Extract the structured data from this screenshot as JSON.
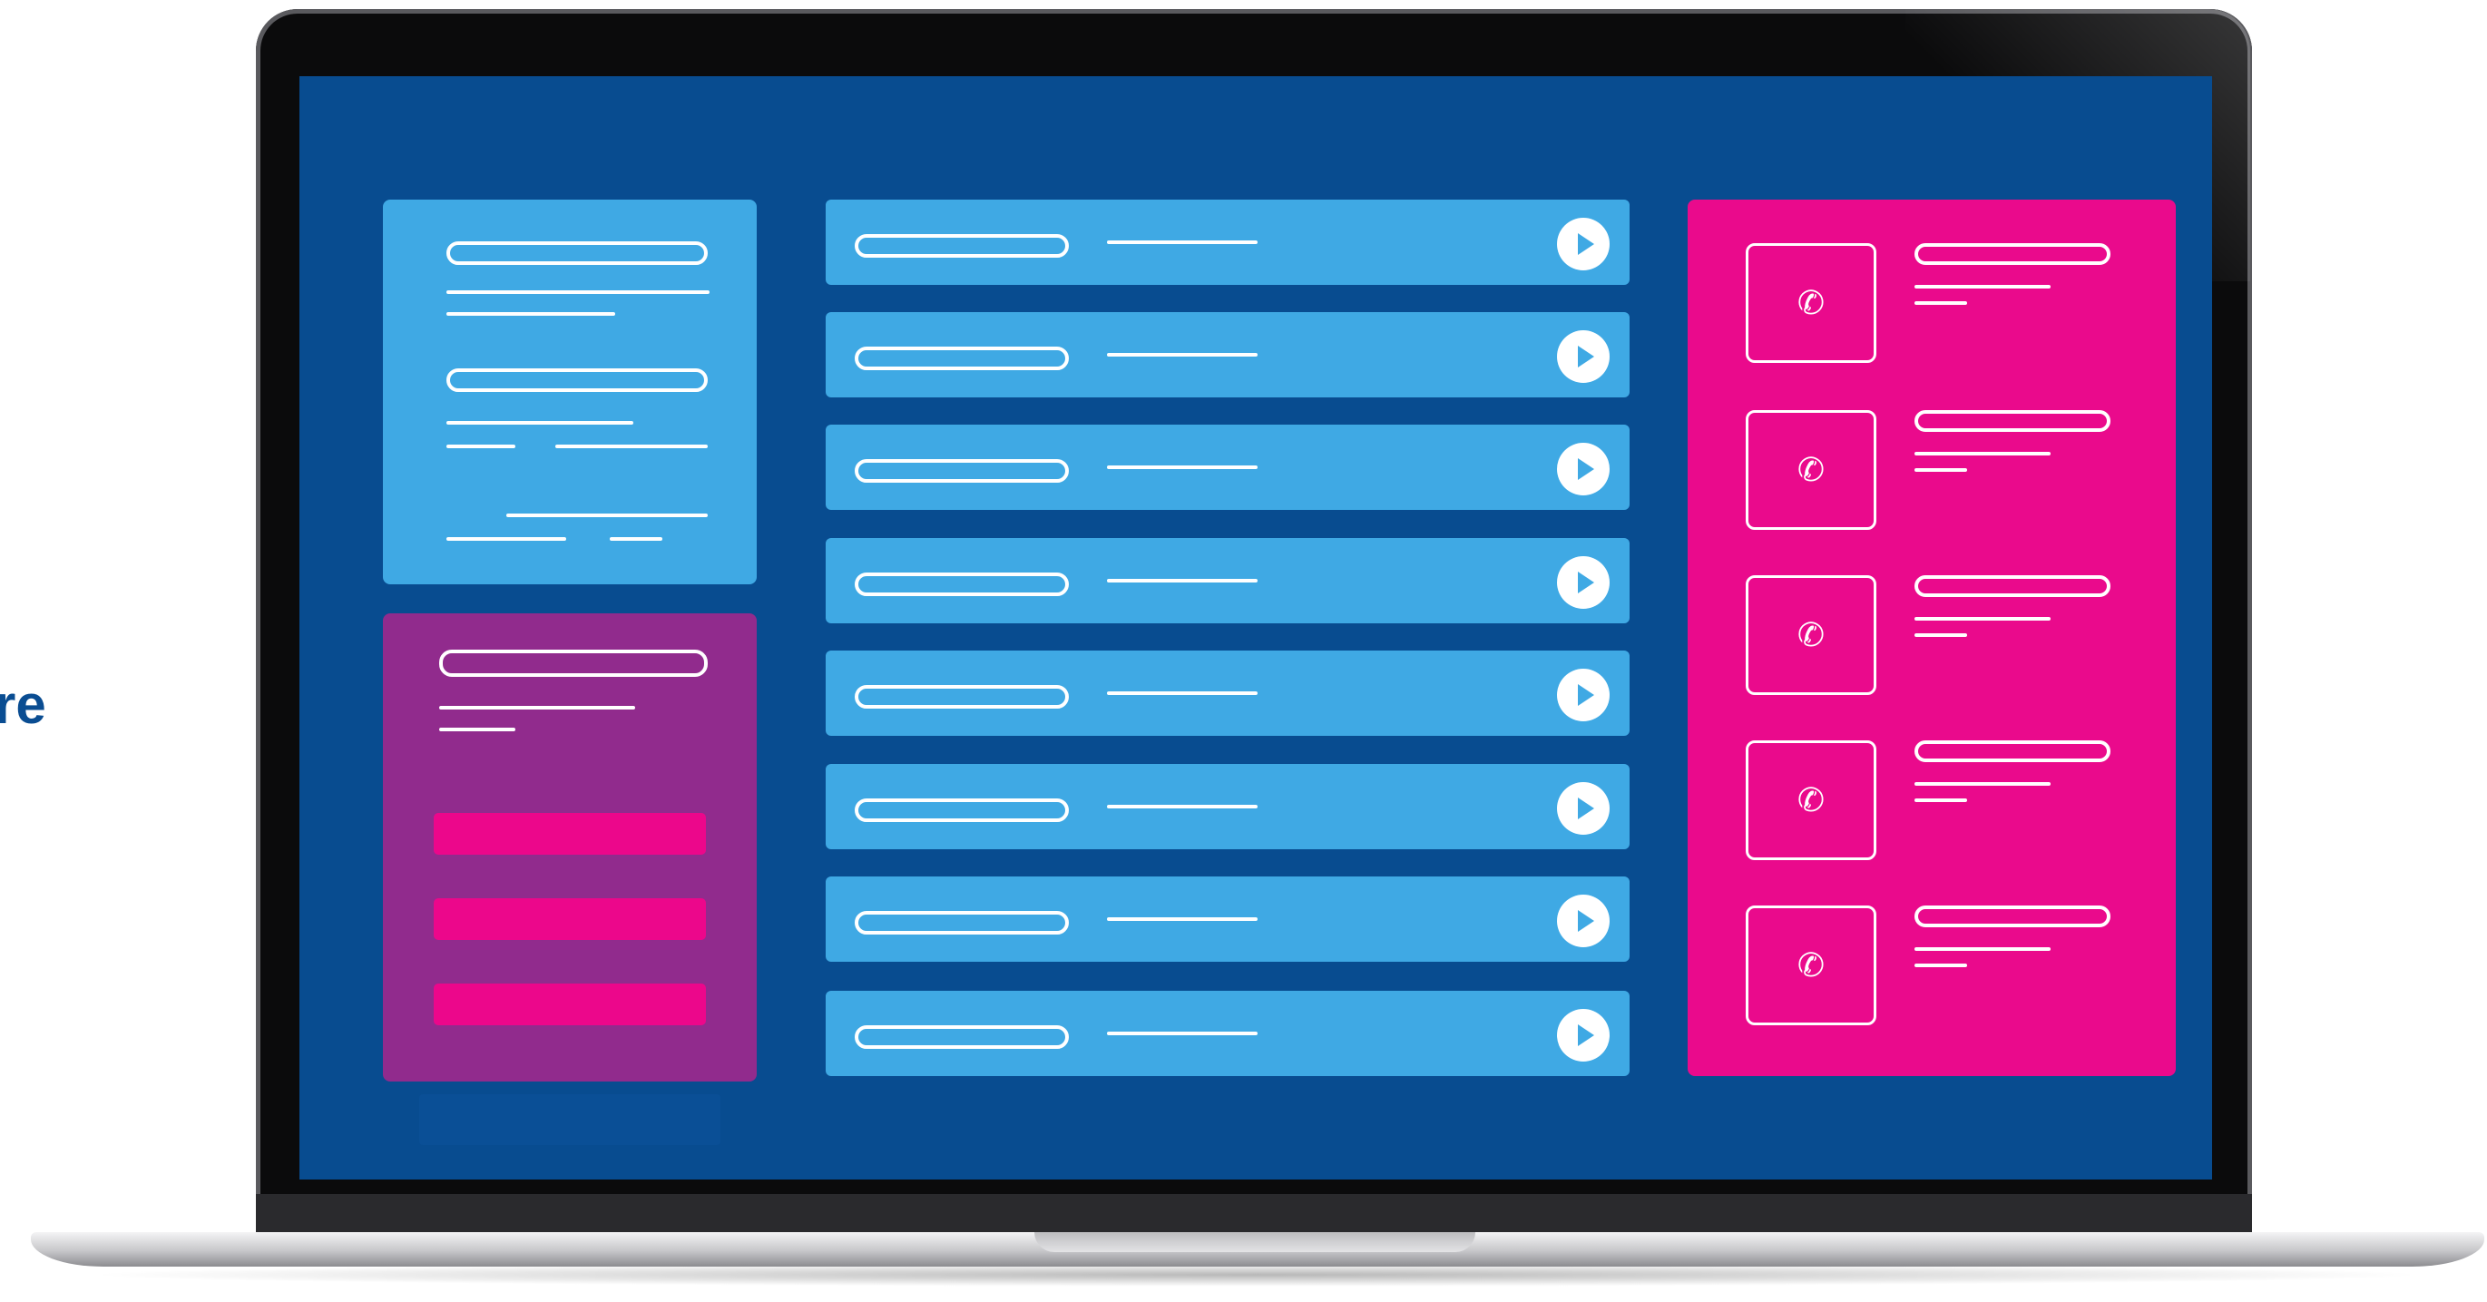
{
  "left_text": "re",
  "screen": {
    "background": "#084c90",
    "colors": {
      "light_blue": "#3fa9e4",
      "purple": "#912b8d",
      "magenta": "#ea0a8c",
      "white": "#ffffff"
    }
  },
  "list_rows": [
    {
      "icon": "play-icon"
    },
    {
      "icon": "play-icon"
    },
    {
      "icon": "play-icon"
    },
    {
      "icon": "play-icon"
    },
    {
      "icon": "play-icon"
    },
    {
      "icon": "play-icon"
    },
    {
      "icon": "play-icon"
    },
    {
      "icon": "play-icon"
    }
  ],
  "call_rows": [
    {
      "icon": "phone-icon",
      "glyph": "✆"
    },
    {
      "icon": "phone-icon",
      "glyph": "✆"
    },
    {
      "icon": "phone-icon",
      "glyph": "✆"
    },
    {
      "icon": "phone-icon",
      "glyph": "✆"
    },
    {
      "icon": "phone-icon",
      "glyph": "✆"
    }
  ]
}
